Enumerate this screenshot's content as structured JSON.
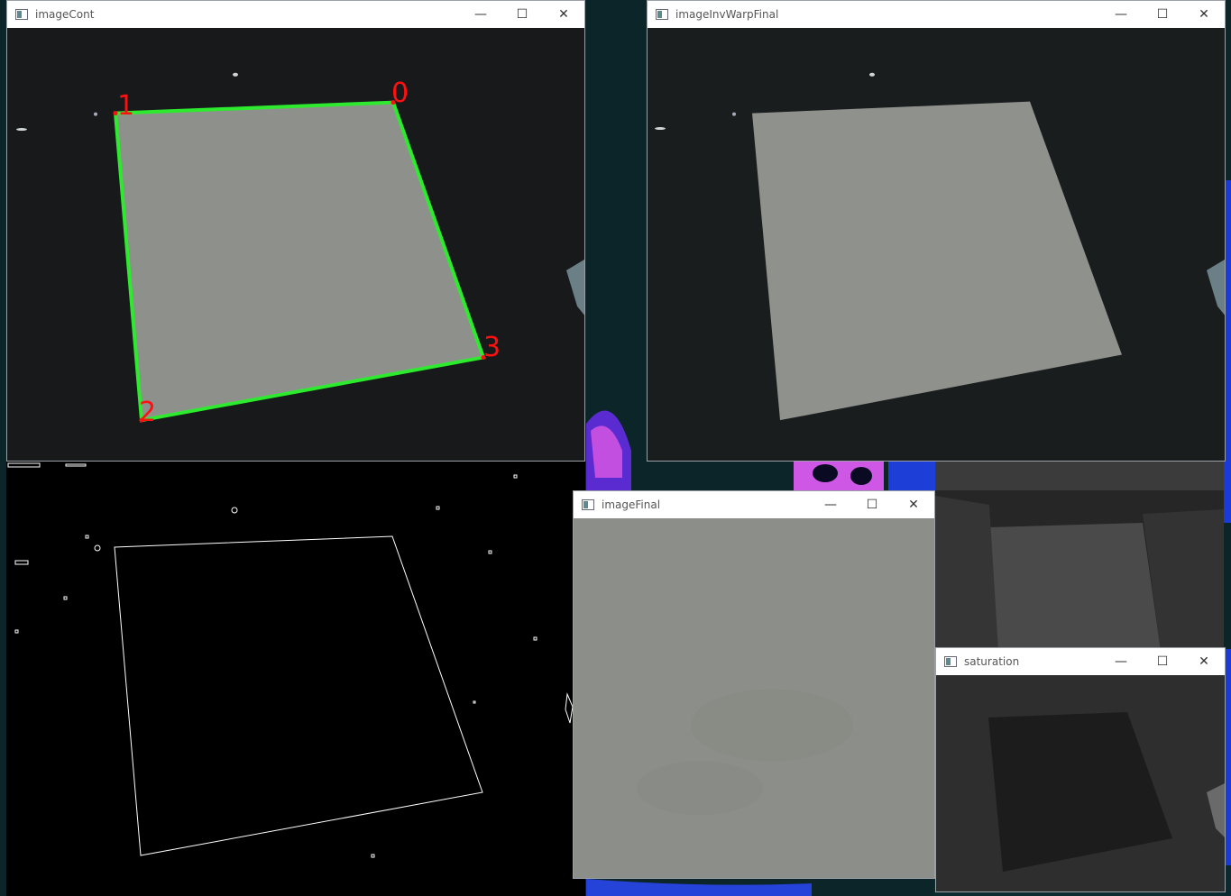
{
  "windows": {
    "image_cont": {
      "title": "imageCont",
      "corner_labels": [
        "0",
        "1",
        "2",
        "3"
      ]
    },
    "image_inv_warp_final": {
      "title": "imageInvWarpFinal"
    },
    "image_final": {
      "title": "imageFinal"
    },
    "saturation": {
      "title": "saturation"
    }
  },
  "controls": {
    "minimize": "—",
    "maximize": "☐",
    "close": "✕"
  },
  "colors": {
    "contour": "#2eea2e",
    "corner_label": "#ff1010",
    "paper": "#8e908c",
    "background_scene": "#1a1d1e"
  },
  "icons": [
    "window-app-icon",
    "minimize-icon",
    "maximize-icon",
    "close-icon"
  ]
}
